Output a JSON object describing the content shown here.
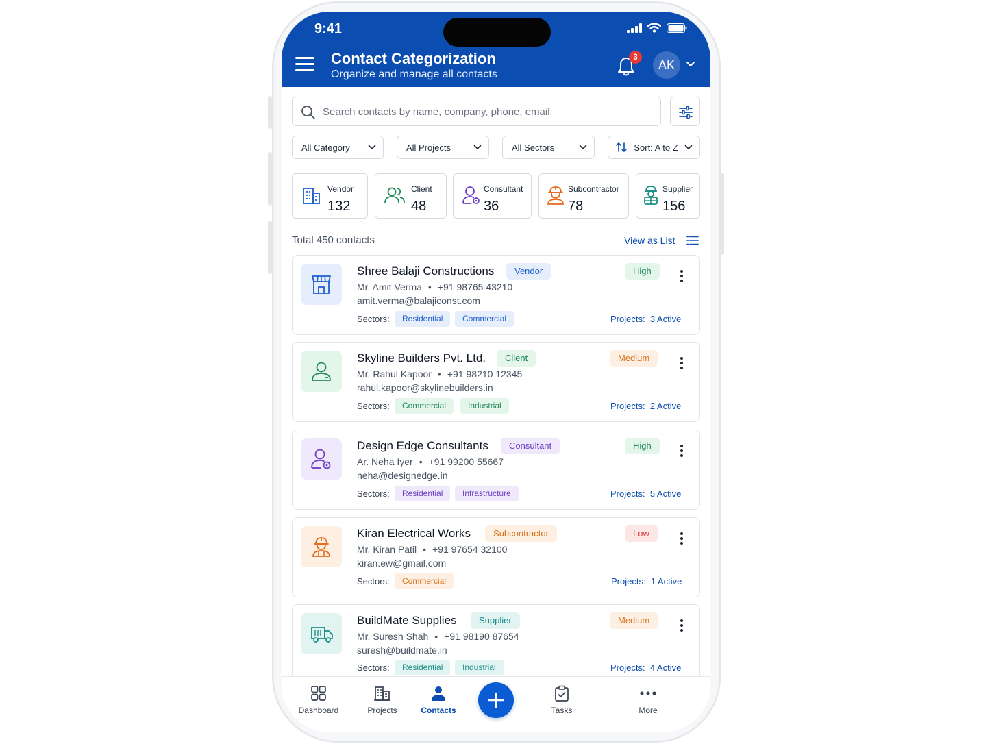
{
  "status_bar": {
    "time": "9:41"
  },
  "header": {
    "title": "Contact Categorization",
    "subtitle": "Organize and manage all contacts",
    "notification_count": "3",
    "avatar_initials": "AK",
    "color": "#0b4db0"
  },
  "search": {
    "placeholder": "Search contacts by name, company, phone, email"
  },
  "filters": {
    "category": "All Category",
    "projects": "All Projects",
    "sectors": "All Sectors",
    "sort": "Sort: A to Z"
  },
  "stats": [
    {
      "label": "Vendor",
      "count": "132",
      "icon": "building-icon",
      "color": "#1d5fd0"
    },
    {
      "label": "Client",
      "count": "48",
      "icon": "users-icon",
      "color": "#1f8a58"
    },
    {
      "label": "Consultant",
      "count": "36",
      "icon": "user-gear-icon",
      "color": "#6d3fc4"
    },
    {
      "label": "Subcontractor",
      "count": "78",
      "icon": "worker-icon",
      "color": "#e86a1c"
    },
    {
      "label": "Supplier",
      "count": "156",
      "icon": "supplier-icon",
      "color": "#1a8f86"
    }
  ],
  "list": {
    "total_text": "Total 450 contacts",
    "view_as_list": "View as List"
  },
  "contacts": [
    {
      "name": "Shree Balaji Constructions",
      "category": "Vendor",
      "priority": "High",
      "person": "Mr. Amit Verma",
      "phone": "+91 98765 43210",
      "email": "amit.verma@balajiconst.com",
      "sectors_label": "Sectors:",
      "sectors": [
        "Residential",
        "Commercial"
      ],
      "projects_label": "Projects:",
      "projects": "3 Active",
      "icon": "store-icon"
    },
    {
      "name": "Skyline Builders Pvt. Ltd.",
      "category": "Client",
      "priority": "Medium",
      "person": "Mr. Rahul Kapoor",
      "phone": "+91 98210 12345",
      "email": "rahul.kapoor@skylinebuilders.in",
      "sectors_label": "Sectors:",
      "sectors": [
        "Commercial",
        "Industrial"
      ],
      "projects_label": "Projects:",
      "projects": "2 Active",
      "icon": "user-icon"
    },
    {
      "name": "Design Edge Consultants",
      "category": "Consultant",
      "priority": "High",
      "person": "Ar. Neha Iyer",
      "phone": "+91 99200 55667",
      "email": "neha@designedge.in",
      "sectors_label": "Sectors:",
      "sectors": [
        "Residential",
        "Infrastructure"
      ],
      "projects_label": "Projects:",
      "projects": "5 Active",
      "icon": "user-gear-icon"
    },
    {
      "name": "Kiran Electrical Works",
      "category": "Subcontractor",
      "priority": "Low",
      "person": "Mr. Kiran Patil",
      "phone": "+91 97654 32100",
      "email": "kiran.ew@gmail.com",
      "sectors_label": "Sectors:",
      "sectors": [
        "Commercial"
      ],
      "projects_label": "Projects:",
      "projects": "1 Active",
      "icon": "worker-icon"
    },
    {
      "name": "BuildMate Supplies",
      "category": "Supplier",
      "priority": "Medium",
      "person": "Mr. Suresh Shah",
      "phone": "+91 98190 87654",
      "email": "suresh@buildmate.in",
      "sectors_label": "Sectors:",
      "sectors": [
        "Residential",
        "Industrial"
      ],
      "projects_label": "Projects:",
      "projects": "4 Active",
      "icon": "truck-icon"
    }
  ],
  "bottom_nav": {
    "dashboard": "Dashboard",
    "projects": "Projects",
    "contacts": "Contacts",
    "tasks": "Tasks",
    "more": "More"
  }
}
